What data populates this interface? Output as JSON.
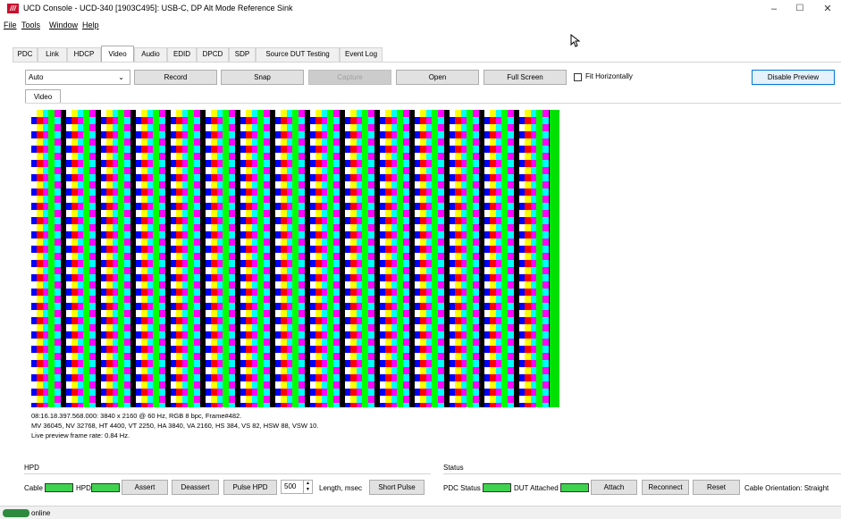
{
  "window": {
    "title": "UCD Console - UCD-340 [1903C495]: USB-C, DP Alt Mode Reference Sink",
    "logo_text": "///",
    "minimize": "–",
    "maximize": "☐",
    "close": "✕"
  },
  "menu": [
    {
      "label": "File"
    },
    {
      "label": "Tools"
    },
    {
      "label": "Window"
    },
    {
      "label": "Help"
    }
  ],
  "tabs": [
    "PDC",
    "Link",
    "HDCP",
    "Video",
    "Audio",
    "EDID",
    "DPCD",
    "SDP",
    "Source DUT Testing",
    "Event Log"
  ],
  "active_tab": "Video",
  "toolbar": {
    "mode_value": "Auto",
    "record": "Record",
    "snap": "Snap",
    "capture": "Capture",
    "open": "Open",
    "full_screen": "Full Screen",
    "fit_horizontally": "Fit Horizontally",
    "disable_preview": "Disable Preview"
  },
  "subtab": "Video",
  "video_info": {
    "line1": "08:16.18.397.568.000: 3840 x 2160 @ 60 Hz, RGB 8 bpc, Frame#482.",
    "line2": "MV 36045, NV 32768, HT 4400, VT 2250, HA 3840, VA 2160, HS 384, VS 82, HSW 88, VSW 10.",
    "line3": "Live preview frame rate: 0.84 Hz."
  },
  "hpd": {
    "group": "HPD",
    "cable": "Cable",
    "hpd": "HPD",
    "assert": "Assert",
    "deassert": "Deassert",
    "pulse_hpd": "Pulse HPD",
    "length_value": "500",
    "length_label": "Length, msec",
    "short_pulse": "Short Pulse"
  },
  "status": {
    "group": "Status",
    "pdc_status": "PDC Status",
    "dut_attached": "DUT Attached",
    "attach": "Attach",
    "reconnect": "Reconnect",
    "reset": "Reset",
    "cable_orientation": "Cable Orientation: Straight"
  },
  "statusbar": {
    "text": "online"
  },
  "colors": {
    "led_green": "#3fd24f",
    "accent": "#0078d7",
    "logo_red": "#c8102e"
  }
}
